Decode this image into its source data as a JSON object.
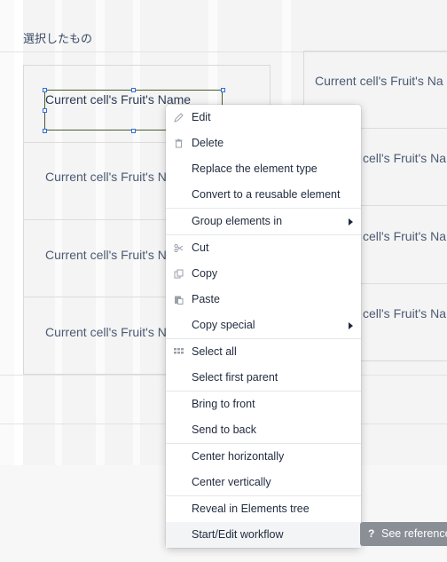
{
  "section_title": "選択したもの",
  "left_cells": [
    "Current cell's Fruit's Name",
    "Current cell's Fruit's N",
    "Current cell's Fruit's N",
    "Current cell's Fruit's N"
  ],
  "right_cells": [
    "Current cell's Fruit's Na",
    "cell's Fruit's Na",
    "cell's Fruit's Na",
    "cell's Fruit's Na"
  ],
  "context_menu": {
    "items": [
      {
        "label": "Edit",
        "icon": "pencil-icon"
      },
      {
        "label": "Delete",
        "icon": "trash-icon"
      },
      {
        "label": "Replace the element type",
        "icon": ""
      },
      {
        "label": "Convert to a reusable element",
        "icon": ""
      },
      {
        "label": "Group elements in",
        "icon": "",
        "submenu": true
      },
      {
        "label": "Cut",
        "icon": "scissors-icon"
      },
      {
        "label": "Copy",
        "icon": "copy-icon"
      },
      {
        "label": "Paste",
        "icon": "paste-icon"
      },
      {
        "label": "Copy special",
        "icon": "",
        "submenu": true
      },
      {
        "label": "Select all",
        "icon": "grid-icon"
      },
      {
        "label": "Select first parent",
        "icon": ""
      },
      {
        "label": "Bring to front",
        "icon": ""
      },
      {
        "label": "Send to back",
        "icon": ""
      },
      {
        "label": "Center horizontally",
        "icon": ""
      },
      {
        "label": "Center vertically",
        "icon": ""
      },
      {
        "label": "Reveal in Elements tree",
        "icon": ""
      },
      {
        "label": "Start/Edit workflow",
        "icon": ""
      }
    ]
  },
  "reference_button": {
    "icon_glyph": "?",
    "label": "See reference"
  },
  "colors": {
    "selection_border": "#4a5a2f",
    "handle_border": "#2f6fd6",
    "menu_hover": "#f3f4f6",
    "reference_button_bg": "#8a8f96"
  }
}
